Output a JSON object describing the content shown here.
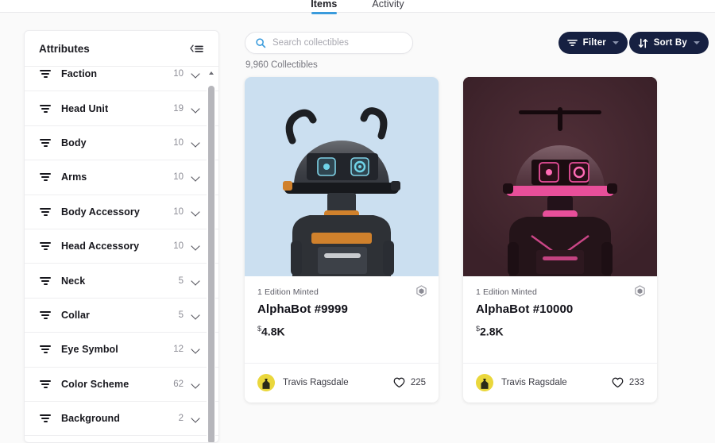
{
  "tabs": [
    {
      "label": "Items",
      "active": true
    },
    {
      "label": "Activity",
      "active": false
    }
  ],
  "sidebar": {
    "title": "Attributes",
    "collapse_icon": "collapse-panel-icon",
    "filter_icon": "filter-lines-icon",
    "chevron_icon": "chevron-down-icon",
    "items": [
      {
        "label": "Faction",
        "count": "10"
      },
      {
        "label": "Head Unit",
        "count": "19"
      },
      {
        "label": "Body",
        "count": "10"
      },
      {
        "label": "Arms",
        "count": "10"
      },
      {
        "label": "Body Accessory",
        "count": "10"
      },
      {
        "label": "Head Accessory",
        "count": "10"
      },
      {
        "label": "Neck",
        "count": "5"
      },
      {
        "label": "Collar",
        "count": "5"
      },
      {
        "label": "Eye Symbol",
        "count": "12"
      },
      {
        "label": "Color Scheme",
        "count": "62"
      },
      {
        "label": "Background",
        "count": "2"
      }
    ]
  },
  "toolbar": {
    "search_placeholder": "Search collectibles",
    "search_value": "",
    "search_icon": "search-icon",
    "filter_label": "Filter",
    "filter_icon": "filter-lines-icon",
    "sort_label": "Sort By",
    "sort_icon": "sort-arrows-icon",
    "caret_icon": "caret-down-icon"
  },
  "results": {
    "count_label": "9,960 Collectibles"
  },
  "colors": {
    "accent_blue": "#3a9bdc",
    "pill_navy": "#162041",
    "page_bg": "#fafafa",
    "card_bg": "#ffffff",
    "avatar_yellow": "#ead73c"
  },
  "cards": [
    {
      "edition": "1 Edition Minted",
      "title": "AlphaBot #9999",
      "currency": "$",
      "price": "4.8K",
      "owner": "Travis Ragsdale",
      "likes": "225",
      "badge_icon": "hexagon-badge-icon",
      "heart_icon": "heart-icon",
      "avatar_icon": "owner-avatar",
      "art": {
        "bg": "#cbdff0",
        "body": "#2e3136",
        "accent": "#d0812c",
        "eye": "#6fd4e8"
      }
    },
    {
      "edition": "1 Edition Minted",
      "title": "AlphaBot #10000",
      "currency": "$",
      "price": "2.8K",
      "owner": "Travis Ragsdale",
      "likes": "233",
      "badge_icon": "hexagon-badge-icon",
      "heart_icon": "heart-icon",
      "avatar_icon": "owner-avatar",
      "art": {
        "bg": "#3b2129",
        "body": "#241419",
        "accent": "#e84f9a",
        "eye": "#ff6bb5"
      }
    }
  ]
}
